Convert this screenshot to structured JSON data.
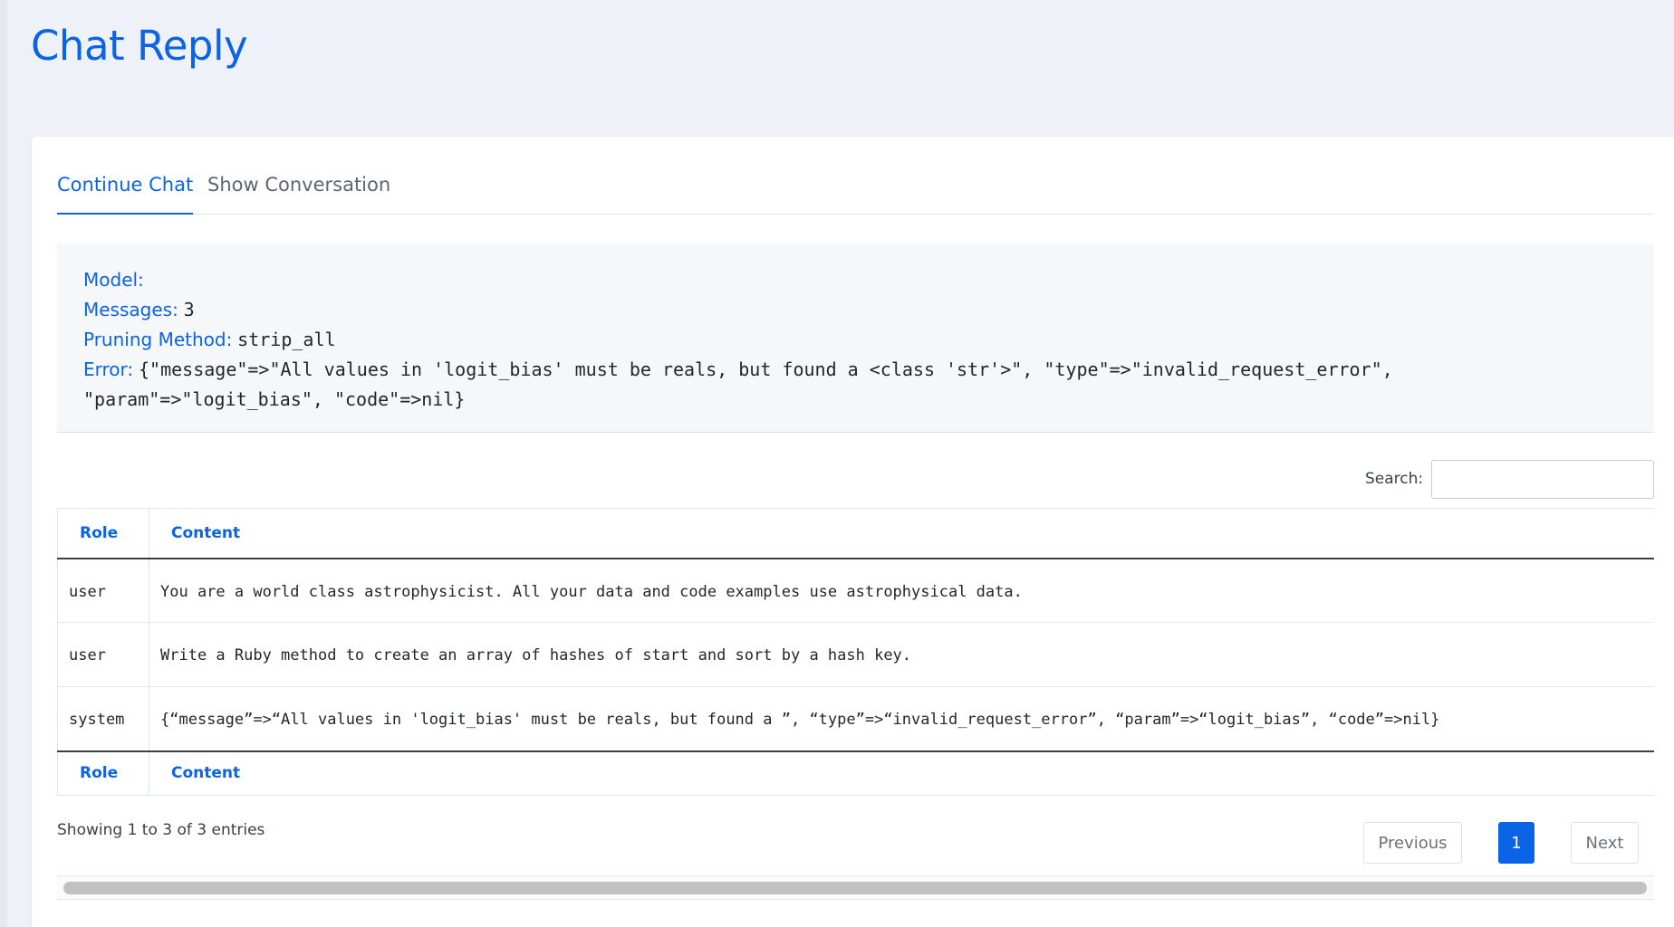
{
  "page": {
    "title": "Chat Reply"
  },
  "tabs": [
    {
      "label": "Continue Chat",
      "active": true
    },
    {
      "label": "Show Conversation",
      "active": false
    }
  ],
  "info": {
    "model_label": "Model:",
    "model_value": "",
    "messages_label": "Messages:",
    "messages_value": "3",
    "pruning_label": "Pruning Method:",
    "pruning_value": "strip_all",
    "error_label": "Error:",
    "error_value": "{\"message\"=>\"All values in 'logit_bias' must be reals, but found a <class 'str'>\", \"type\"=>\"invalid_request_error\", \"param\"=>\"logit_bias\", \"code\"=>nil}"
  },
  "search": {
    "label": "Search:",
    "value": ""
  },
  "table": {
    "headers": [
      "Role",
      "Content"
    ],
    "rows": [
      {
        "role": "user",
        "content": "You are a world class astrophysicist. All your data and code examples use astrophysical data."
      },
      {
        "role": "user",
        "content": "Write a Ruby method to create an array of hashes of start and sort by a hash key."
      },
      {
        "role": "system",
        "content": "{“message”=>“All values in 'logit_bias' must be reals, but found a ”, “type”=>“invalid_request_error”, “param”=>“logit_bias”, “code”=>nil}"
      }
    ]
  },
  "footer": {
    "entries_info": "Showing 1 to 3 of 3 entries",
    "previous_label": "Previous",
    "page_label": "1",
    "next_label": "Next"
  },
  "colors": {
    "accent": "#0b63e5",
    "background": "#eef1f7"
  }
}
